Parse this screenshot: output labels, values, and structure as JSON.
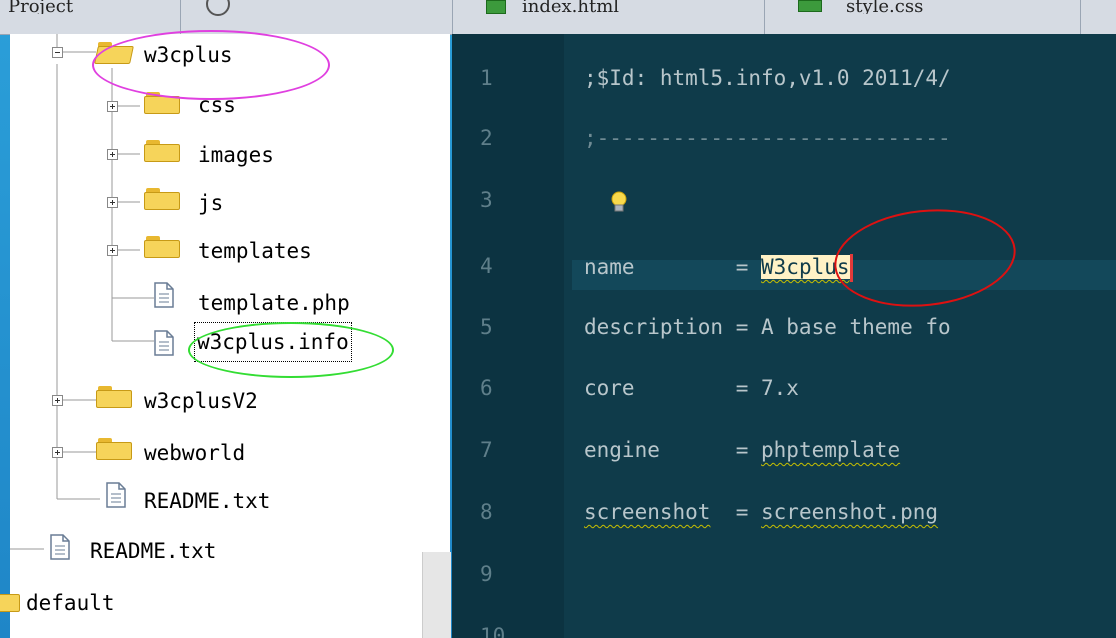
{
  "tabs": [
    "Project",
    "index.html",
    "style.css"
  ],
  "tree": [
    {
      "label": "w3cplus",
      "type": "folder-open"
    },
    {
      "label": "css",
      "type": "folder"
    },
    {
      "label": "images",
      "type": "folder"
    },
    {
      "label": "js",
      "type": "folder"
    },
    {
      "label": "templates",
      "type": "folder"
    },
    {
      "label": "template.php",
      "type": "file"
    },
    {
      "label": "w3cplus.info",
      "type": "file"
    },
    {
      "label": "w3cplusV2",
      "type": "folder"
    },
    {
      "label": "webworld",
      "type": "folder"
    },
    {
      "label": "README.txt",
      "type": "file"
    },
    {
      "label": "README.txt",
      "type": "file"
    },
    {
      "label": "default",
      "type": "folder"
    }
  ],
  "editor": {
    "line_numbers": [
      "1",
      "2",
      "3",
      "4",
      "5",
      "6",
      "7",
      "8",
      "9",
      "10"
    ],
    "lines": [
      ";$Id: html5.info,v1.0 2011/4/",
      ";----------------------------",
      "",
      "",
      "description = A base theme fo",
      "core        = 7.x",
      "",
      "",
      "",
      ""
    ],
    "line4_key": "name        = ",
    "line4_value": "W3cplus",
    "line7_key": "engine      = ",
    "line7_value": "phptemplate",
    "line8_key": "screenshot",
    "line8_mid": "  = ",
    "line8_value": "screenshot.png"
  },
  "colors": {
    "background": "#2196d6",
    "editor_bg": "#0f3b4a",
    "annotation_magenta": "#e040e0",
    "annotation_green": "#33dd33",
    "annotation_red": "#dd1111"
  }
}
